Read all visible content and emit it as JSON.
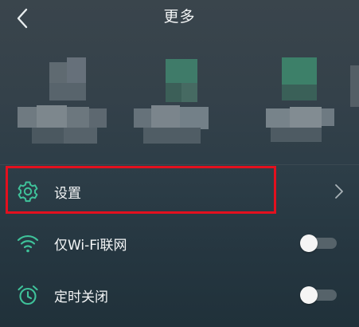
{
  "header": {
    "title": "更多",
    "back_icon": "chevron-left-icon"
  },
  "menu": {
    "items": [
      {
        "label": "设置",
        "icon": "gear-icon",
        "control": "chevron-right-icon"
      },
      {
        "label": "仅Wi-Fi联网",
        "icon": "wifi-icon",
        "control": "toggle",
        "toggle_on": false
      },
      {
        "label": "定时关闭",
        "icon": "alarm-clock-icon",
        "control": "toggle",
        "toggle_on": false
      }
    ]
  },
  "colors": {
    "accent": "#3fc29a",
    "highlight": "#e3101e",
    "toggle_track": "#56636a",
    "toggle_knob": "#f5f5f5"
  }
}
